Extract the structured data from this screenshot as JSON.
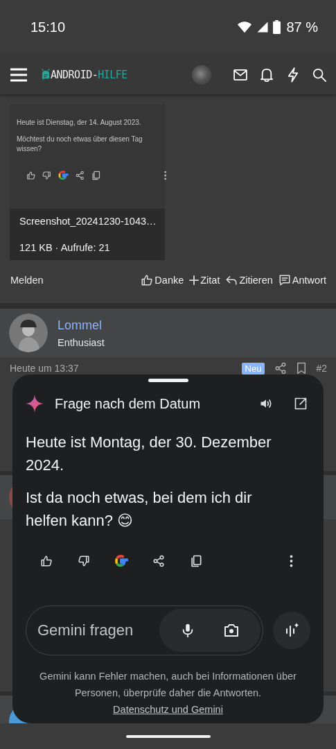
{
  "status_bar": {
    "time": "15:10",
    "battery": "87 %"
  },
  "header": {
    "logo_main": "ANDROID-",
    "logo_accent": "HILFE"
  },
  "attachment": {
    "thumbnail_lines": [
      "Heute ist Dienstag, der 14. August 2023.",
      "Möchtest du noch etwas über diesen Tag wissen?"
    ],
    "filename": "Screenshot_20241230-1043…",
    "meta": "121 KB · Aufrufe: 21"
  },
  "post_actions": {
    "report": "Melden",
    "actions": [
      {
        "kind": "like",
        "label": "Danke"
      },
      {
        "kind": "add",
        "label": "Zitat"
      },
      {
        "kind": "quote",
        "label": "Zitieren"
      },
      {
        "kind": "reply",
        "label": "Antwort"
      }
    ]
  },
  "post": {
    "author": "Lommel",
    "role": "Enthusiast",
    "time": "Heute um 13:37",
    "badge": "Neu",
    "number": "#2"
  },
  "gemini": {
    "title": "Frage nach dem Datum",
    "paragraphs": [
      "Heute ist Montag, der 30. Dezember 2024.",
      "Ist da noch etwas, bei dem ich dir helfen kann? 😊"
    ],
    "input": {
      "placeholder": "Gemini fragen"
    },
    "disclaimer": "Gemini kann Fehler machen, auch bei Informationen über Personen, überprüfe daher die Antworten.",
    "link": "Datenschutz und Gemini"
  }
}
